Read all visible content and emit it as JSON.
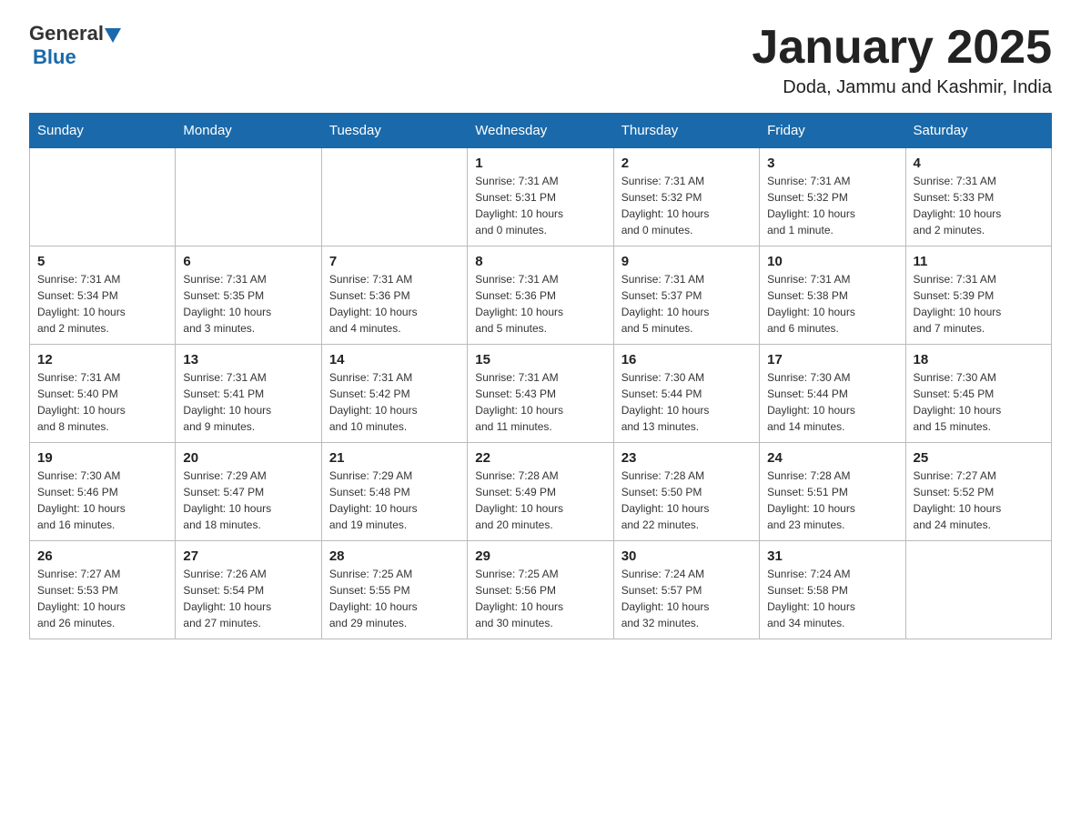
{
  "header": {
    "logo": {
      "text_general": "General",
      "text_blue": "Blue",
      "arrow_label": "logo-arrow"
    },
    "month_title": "January 2025",
    "location": "Doda, Jammu and Kashmir, India"
  },
  "weekdays": [
    "Sunday",
    "Monday",
    "Tuesday",
    "Wednesday",
    "Thursday",
    "Friday",
    "Saturday"
  ],
  "weeks": [
    [
      {
        "day": "",
        "info": ""
      },
      {
        "day": "",
        "info": ""
      },
      {
        "day": "",
        "info": ""
      },
      {
        "day": "1",
        "info": "Sunrise: 7:31 AM\nSunset: 5:31 PM\nDaylight: 10 hours\nand 0 minutes."
      },
      {
        "day": "2",
        "info": "Sunrise: 7:31 AM\nSunset: 5:32 PM\nDaylight: 10 hours\nand 0 minutes."
      },
      {
        "day": "3",
        "info": "Sunrise: 7:31 AM\nSunset: 5:32 PM\nDaylight: 10 hours\nand 1 minute."
      },
      {
        "day": "4",
        "info": "Sunrise: 7:31 AM\nSunset: 5:33 PM\nDaylight: 10 hours\nand 2 minutes."
      }
    ],
    [
      {
        "day": "5",
        "info": "Sunrise: 7:31 AM\nSunset: 5:34 PM\nDaylight: 10 hours\nand 2 minutes."
      },
      {
        "day": "6",
        "info": "Sunrise: 7:31 AM\nSunset: 5:35 PM\nDaylight: 10 hours\nand 3 minutes."
      },
      {
        "day": "7",
        "info": "Sunrise: 7:31 AM\nSunset: 5:36 PM\nDaylight: 10 hours\nand 4 minutes."
      },
      {
        "day": "8",
        "info": "Sunrise: 7:31 AM\nSunset: 5:36 PM\nDaylight: 10 hours\nand 5 minutes."
      },
      {
        "day": "9",
        "info": "Sunrise: 7:31 AM\nSunset: 5:37 PM\nDaylight: 10 hours\nand 5 minutes."
      },
      {
        "day": "10",
        "info": "Sunrise: 7:31 AM\nSunset: 5:38 PM\nDaylight: 10 hours\nand 6 minutes."
      },
      {
        "day": "11",
        "info": "Sunrise: 7:31 AM\nSunset: 5:39 PM\nDaylight: 10 hours\nand 7 minutes."
      }
    ],
    [
      {
        "day": "12",
        "info": "Sunrise: 7:31 AM\nSunset: 5:40 PM\nDaylight: 10 hours\nand 8 minutes."
      },
      {
        "day": "13",
        "info": "Sunrise: 7:31 AM\nSunset: 5:41 PM\nDaylight: 10 hours\nand 9 minutes."
      },
      {
        "day": "14",
        "info": "Sunrise: 7:31 AM\nSunset: 5:42 PM\nDaylight: 10 hours\nand 10 minutes."
      },
      {
        "day": "15",
        "info": "Sunrise: 7:31 AM\nSunset: 5:43 PM\nDaylight: 10 hours\nand 11 minutes."
      },
      {
        "day": "16",
        "info": "Sunrise: 7:30 AM\nSunset: 5:44 PM\nDaylight: 10 hours\nand 13 minutes."
      },
      {
        "day": "17",
        "info": "Sunrise: 7:30 AM\nSunset: 5:44 PM\nDaylight: 10 hours\nand 14 minutes."
      },
      {
        "day": "18",
        "info": "Sunrise: 7:30 AM\nSunset: 5:45 PM\nDaylight: 10 hours\nand 15 minutes."
      }
    ],
    [
      {
        "day": "19",
        "info": "Sunrise: 7:30 AM\nSunset: 5:46 PM\nDaylight: 10 hours\nand 16 minutes."
      },
      {
        "day": "20",
        "info": "Sunrise: 7:29 AM\nSunset: 5:47 PM\nDaylight: 10 hours\nand 18 minutes."
      },
      {
        "day": "21",
        "info": "Sunrise: 7:29 AM\nSunset: 5:48 PM\nDaylight: 10 hours\nand 19 minutes."
      },
      {
        "day": "22",
        "info": "Sunrise: 7:28 AM\nSunset: 5:49 PM\nDaylight: 10 hours\nand 20 minutes."
      },
      {
        "day": "23",
        "info": "Sunrise: 7:28 AM\nSunset: 5:50 PM\nDaylight: 10 hours\nand 22 minutes."
      },
      {
        "day": "24",
        "info": "Sunrise: 7:28 AM\nSunset: 5:51 PM\nDaylight: 10 hours\nand 23 minutes."
      },
      {
        "day": "25",
        "info": "Sunrise: 7:27 AM\nSunset: 5:52 PM\nDaylight: 10 hours\nand 24 minutes."
      }
    ],
    [
      {
        "day": "26",
        "info": "Sunrise: 7:27 AM\nSunset: 5:53 PM\nDaylight: 10 hours\nand 26 minutes."
      },
      {
        "day": "27",
        "info": "Sunrise: 7:26 AM\nSunset: 5:54 PM\nDaylight: 10 hours\nand 27 minutes."
      },
      {
        "day": "28",
        "info": "Sunrise: 7:25 AM\nSunset: 5:55 PM\nDaylight: 10 hours\nand 29 minutes."
      },
      {
        "day": "29",
        "info": "Sunrise: 7:25 AM\nSunset: 5:56 PM\nDaylight: 10 hours\nand 30 minutes."
      },
      {
        "day": "30",
        "info": "Sunrise: 7:24 AM\nSunset: 5:57 PM\nDaylight: 10 hours\nand 32 minutes."
      },
      {
        "day": "31",
        "info": "Sunrise: 7:24 AM\nSunset: 5:58 PM\nDaylight: 10 hours\nand 34 minutes."
      },
      {
        "day": "",
        "info": ""
      }
    ]
  ]
}
